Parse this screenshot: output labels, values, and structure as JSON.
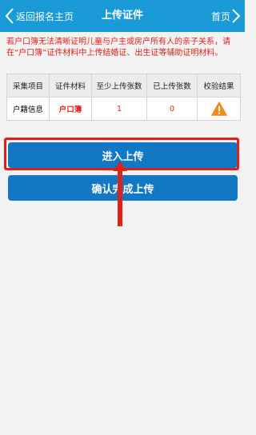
{
  "header": {
    "back_label": "返回报名主页",
    "title": "上传证件",
    "home_label": "首页"
  },
  "notice": "若户口簿无法清晰证明儿童与户主或房产所有人的亲子关系，请在“户口簿”证件材料中上传结婚证、出生证等辅助证明材料。",
  "table": {
    "headers": [
      "采集项目",
      "证件材料",
      "至少上传张数",
      "已上传张数",
      "校验结果"
    ],
    "rows": [
      {
        "item": "户籍信息",
        "doc": "户口簿",
        "min_count": "1",
        "uploaded_count": "0",
        "result_icon": "warning-icon"
      }
    ]
  },
  "buttons": {
    "upload": "进入上传",
    "confirm": "确认完成上传"
  },
  "colors": {
    "header_bg": "#1a9ad6",
    "button_bg": "#1278c6",
    "alert_red": "#e0211a",
    "warning_orange": "#f08c1e"
  }
}
